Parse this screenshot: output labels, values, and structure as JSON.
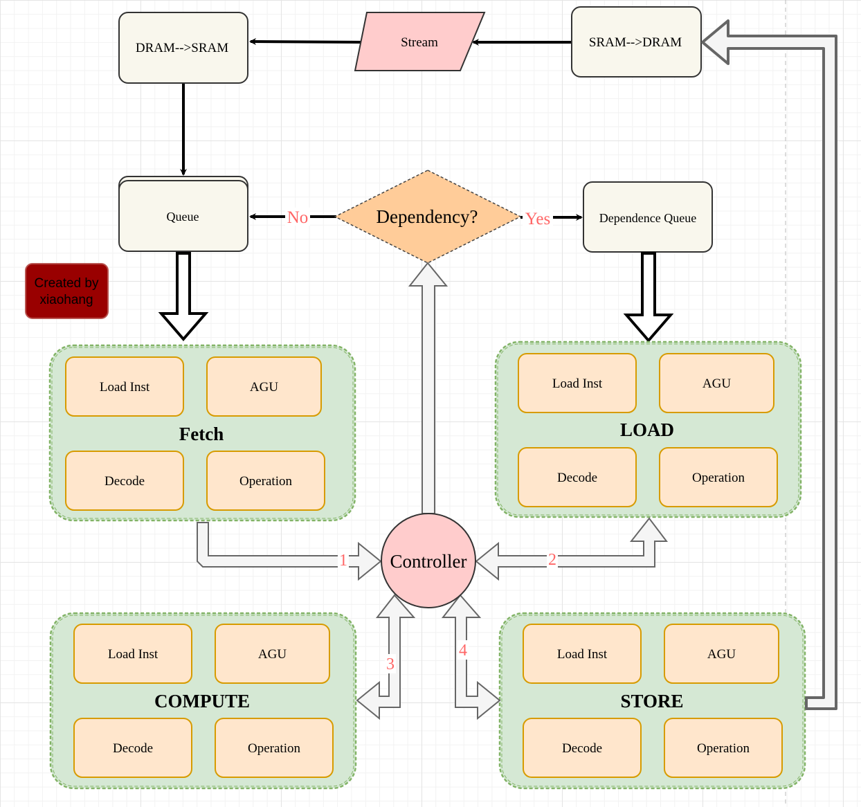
{
  "nodes": {
    "dram_to_sram": "DRAM-->SRAM",
    "stream": "Stream",
    "sram_to_dram": "SRAM-->DRAM",
    "queue": "Queue",
    "dependency": "Dependency?",
    "dependence_queue": "Dependence Queue",
    "controller": "Controller",
    "credit": "Created by xiaohang",
    "credit_line1": "Created by",
    "credit_line2": "xiaohang"
  },
  "edge_labels": {
    "no": "No",
    "yes": "Yes",
    "one": "1",
    "two": "2",
    "three": "3",
    "four": "4"
  },
  "groups": [
    {
      "title": "Fetch",
      "items": [
        "Load Inst",
        "AGU",
        "Decode",
        "Operation"
      ]
    },
    {
      "title": "LOAD",
      "items": [
        "Load Inst",
        "AGU",
        "Decode",
        "Operation"
      ]
    },
    {
      "title": "COMPUTE",
      "items": [
        "Load Inst",
        "AGU",
        "Decode",
        "Operation"
      ]
    },
    {
      "title": "STORE",
      "items": [
        "Load Inst",
        "AGU",
        "Decode",
        "Operation"
      ]
    }
  ],
  "colors": {
    "box_fill": "#f9f7ed",
    "stream_fill": "#ffcccc",
    "diamond_fill": "#ffcc99",
    "group_fill": "#d5e8d4",
    "group_stroke": "#82b366",
    "item_fill": "#ffe6cc",
    "item_stroke": "#d79b00",
    "controller_fill": "#ffcccc",
    "credit_fill": "#990000",
    "label_red": "#ff6666",
    "block_arrow_fill": "#f5f5f5"
  }
}
